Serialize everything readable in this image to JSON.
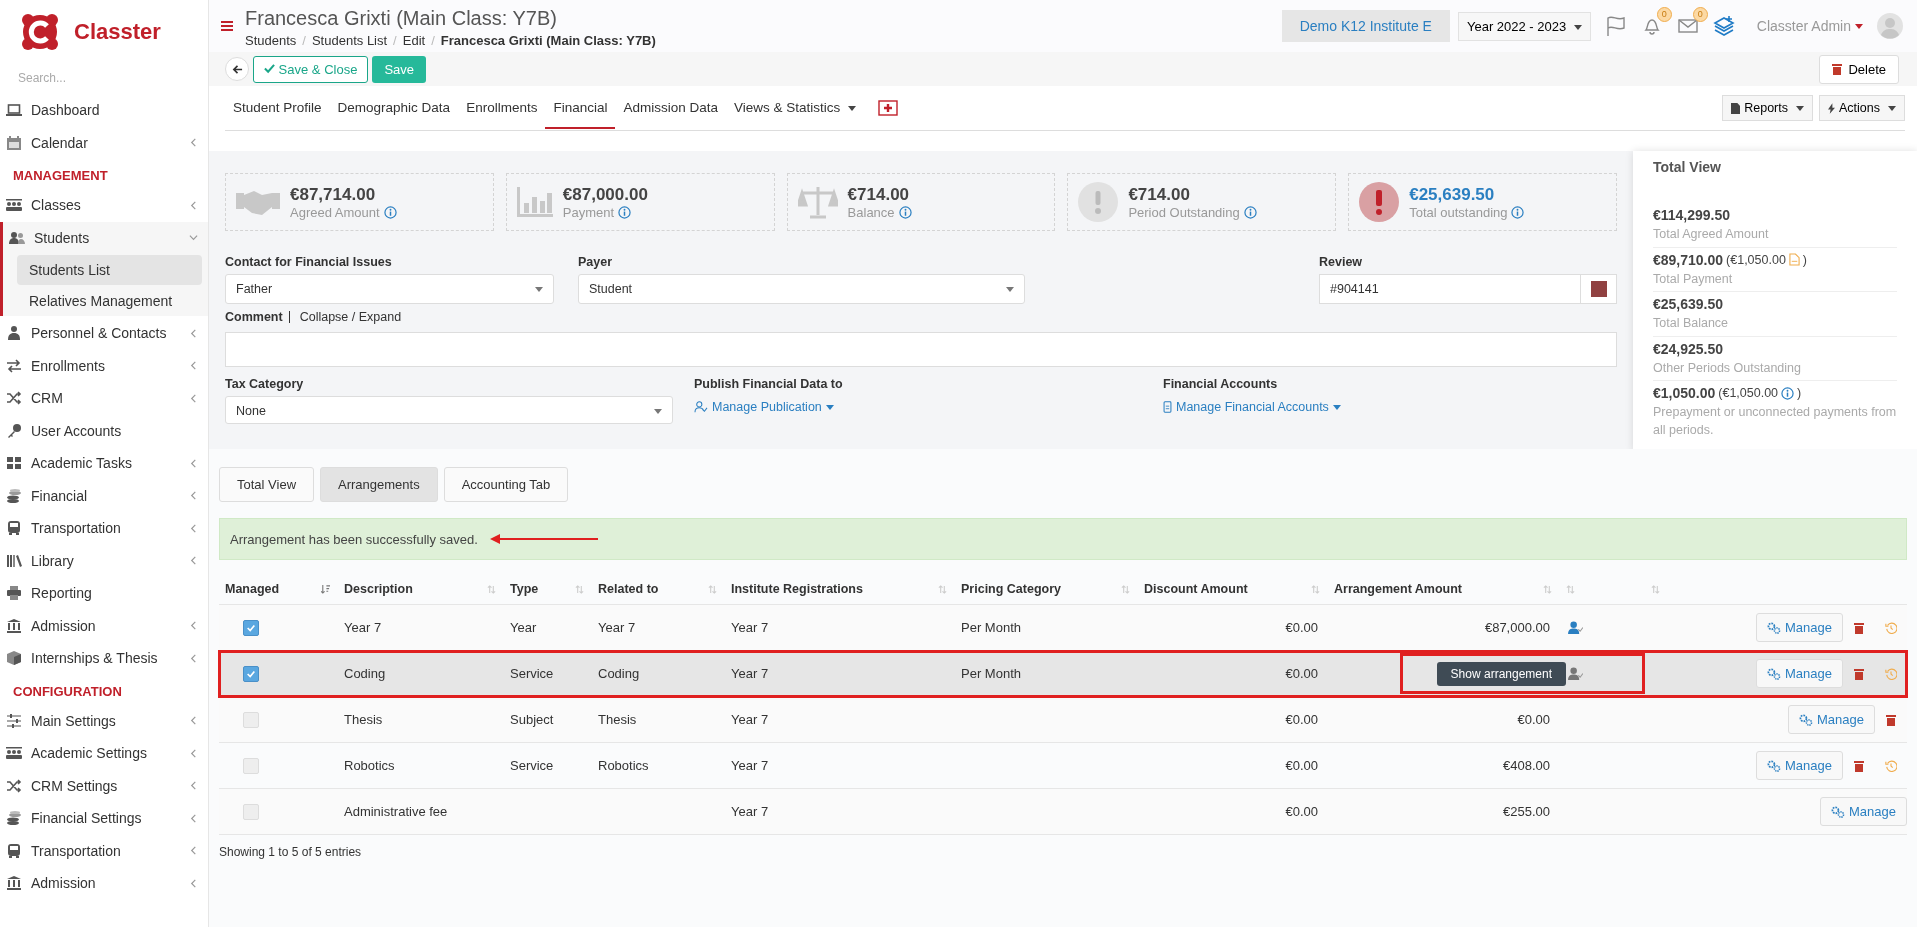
{
  "sidebar": {
    "logo": "Classter",
    "search": {
      "placeholder": "Search..."
    },
    "sections": [
      {
        "items": [
          {
            "label": "Dashboard",
            "has_submenu": false,
            "selected": false
          },
          {
            "label": "Calendar",
            "has_submenu": true,
            "expanded": false,
            "selected": false
          }
        ]
      },
      {
        "heading": "MANAGEMENT",
        "items": [
          {
            "label": "Classes",
            "has_submenu": true,
            "expanded": false,
            "selected": false
          },
          {
            "label": "Students",
            "has_submenu": true,
            "expanded": true,
            "selected": true,
            "children": [
              {
                "label": "Students List",
                "selected": true
              },
              {
                "label": "Relatives Management",
                "selected": false
              }
            ]
          },
          {
            "label": "Personnel & Contacts",
            "has_submenu": true,
            "expanded": false,
            "selected": false
          },
          {
            "label": "Enrollments",
            "has_submenu": true,
            "expanded": false,
            "selected": false
          },
          {
            "label": "CRM",
            "has_submenu": true,
            "expanded": false,
            "selected": false
          },
          {
            "label": "User Accounts",
            "has_submenu": false,
            "selected": false
          },
          {
            "label": "Academic Tasks",
            "has_submenu": true,
            "expanded": false,
            "selected": false
          },
          {
            "label": "Financial",
            "has_submenu": true,
            "expanded": false,
            "selected": false
          },
          {
            "label": "Transportation",
            "has_submenu": true,
            "expanded": false,
            "selected": false
          },
          {
            "label": "Library",
            "has_submenu": true,
            "expanded": false,
            "selected": false
          },
          {
            "label": "Reporting",
            "has_submenu": false,
            "selected": false
          },
          {
            "label": "Admission",
            "has_submenu": true,
            "expanded": false,
            "selected": false
          },
          {
            "label": "Internships & Thesis",
            "has_submenu": true,
            "expanded": false,
            "selected": false
          }
        ]
      },
      {
        "heading": "CONFIGURATION",
        "items": [
          {
            "label": "Main Settings",
            "has_submenu": true,
            "expanded": false,
            "selected": false
          },
          {
            "label": "Academic Settings",
            "has_submenu": true,
            "expanded": false,
            "selected": false
          },
          {
            "label": "CRM Settings",
            "has_submenu": true,
            "expanded": false,
            "selected": false
          },
          {
            "label": "Financial Settings",
            "has_submenu": true,
            "expanded": false,
            "selected": false
          },
          {
            "label": "Transportation",
            "has_submenu": true,
            "expanded": false,
            "selected": false
          },
          {
            "label": "Admission",
            "has_submenu": true,
            "expanded": false,
            "selected": false
          }
        ]
      }
    ]
  },
  "header": {
    "title": "Francesca Grixti (Main Class: Y7B)",
    "breadcrumbs": [
      {
        "label": "Students",
        "current": false
      },
      {
        "label": "Students List",
        "current": false
      },
      {
        "label": "Edit",
        "current": false
      },
      {
        "label": "Francesca Grixti (Main Class: Y7B)",
        "current": true
      }
    ],
    "separator": "/",
    "institute": "Demo K12 Institute E",
    "year": "Year 2022 - 2023",
    "notifications": "0",
    "messages": "0",
    "user": "Classter Admin"
  },
  "toolbar": {
    "save_close": "Save & Close",
    "save": "Save",
    "delete": "Delete"
  },
  "tabs": [
    {
      "label": "Student Profile",
      "selected": false,
      "has_menu": false
    },
    {
      "label": "Demographic Data",
      "selected": false,
      "has_menu": false
    },
    {
      "label": "Enrollments",
      "selected": false,
      "has_menu": false
    },
    {
      "label": "Financial",
      "selected": true,
      "has_menu": false
    },
    {
      "label": "Admission Data",
      "selected": false,
      "has_menu": false
    },
    {
      "label": "Views & Statistics",
      "selected": false,
      "has_menu": true
    }
  ],
  "tab_actions": [
    "Reports",
    "Actions"
  ],
  "stats": [
    {
      "value": "€87,714.00",
      "label": "Agreed Amount",
      "alert": false
    },
    {
      "value": "€87,000.00",
      "label": "Payment",
      "alert": false
    },
    {
      "value": "€714.00",
      "label": "Balance",
      "alert": false
    },
    {
      "value": "€714.00",
      "label": "Period Outstanding",
      "alert": false
    },
    {
      "value": "€25,639.50",
      "label": "Total outstanding",
      "alert": true
    }
  ],
  "form": {
    "contact": {
      "label": "Contact for Financial Issues",
      "value": "Father"
    },
    "payer": {
      "label": "Payer",
      "value": "Student"
    },
    "review": {
      "label": "Review",
      "value": "#904141"
    },
    "comment": {
      "label": "Comment",
      "toggle": "Collapse / Expand"
    },
    "tax": {
      "label": "Tax Category",
      "value": "None"
    },
    "publish": {
      "label": "Publish Financial Data to",
      "link": "Manage Publication"
    },
    "accounts": {
      "label": "Financial Accounts",
      "link": "Manage Financial Accounts"
    }
  },
  "total_view": {
    "title": "Total View",
    "entries": [
      {
        "value": "€114,299.50",
        "label": "Total Agreed Amount"
      },
      {
        "value": "€89,710.00",
        "note": {
          "kind": "file",
          "text": "(€1,050.00",
          "close": ")"
        },
        "label": "Total Payment"
      },
      {
        "value": "€25,639.50",
        "label": "Total Balance"
      },
      {
        "value": "€24,925.50",
        "label": "Other Periods Outstanding"
      },
      {
        "value": "€1,050.00",
        "note": {
          "kind": "info",
          "text": "(€1,050.00",
          "close": ")"
        },
        "label": "Prepayment or unconnected payments from all periods."
      }
    ]
  },
  "section_tabs": [
    {
      "label": "Total View",
      "selected": false
    },
    {
      "label": "Arrangements",
      "selected": true
    },
    {
      "label": "Accounting Tab",
      "selected": false
    }
  ],
  "alert": "Arrangement has been successfully saved.",
  "table": {
    "columns": [
      "Managed",
      "Description",
      "Type",
      "Related to",
      "Institute Registrations",
      "Pricing Category",
      "Discount Amount",
      "Arrangement Amount"
    ],
    "rows": [
      {
        "checked": true,
        "disabled": false,
        "selected": false,
        "description": "Year 7",
        "type": "Year",
        "related_to": "Year 7",
        "registrations": "Year 7",
        "pricing": "Per Month",
        "discount": "€0.00",
        "amount": "€87,000.00",
        "assigned": true,
        "manage": "Manage",
        "deletable": true,
        "history": true
      },
      {
        "checked": true,
        "disabled": false,
        "selected": true,
        "description": "Coding",
        "type": "Service",
        "related_to": "Coding",
        "registrations": "Year 7",
        "pricing": "Per Month",
        "discount": "€0.00",
        "tooltip": "Show arrangement",
        "assigned": true,
        "manage": "Manage",
        "deletable": true,
        "history": true
      },
      {
        "checked": false,
        "disabled": true,
        "selected": false,
        "description": "Thesis",
        "type": "Subject",
        "related_to": "Thesis",
        "registrations": "Year 7",
        "discount": "€0.00",
        "amount": "€0.00",
        "assigned": false,
        "manage": "Manage",
        "deletable": true,
        "history": false
      },
      {
        "checked": false,
        "disabled": true,
        "selected": false,
        "description": "Robotics",
        "type": "Service",
        "related_to": "Robotics",
        "registrations": "Year 7",
        "discount": "€0.00",
        "amount": "€408.00",
        "assigned": false,
        "manage": "Manage",
        "deletable": true,
        "history": true
      },
      {
        "checked": false,
        "disabled": true,
        "selected": false,
        "description": "Administrative fee",
        "registrations": "Year 7",
        "discount": "€0.00",
        "amount": "€255.00",
        "assigned": false,
        "manage": "Manage",
        "deletable": false,
        "history": false
      }
    ],
    "footer": "Showing 1 to 5 of 5 entries"
  }
}
